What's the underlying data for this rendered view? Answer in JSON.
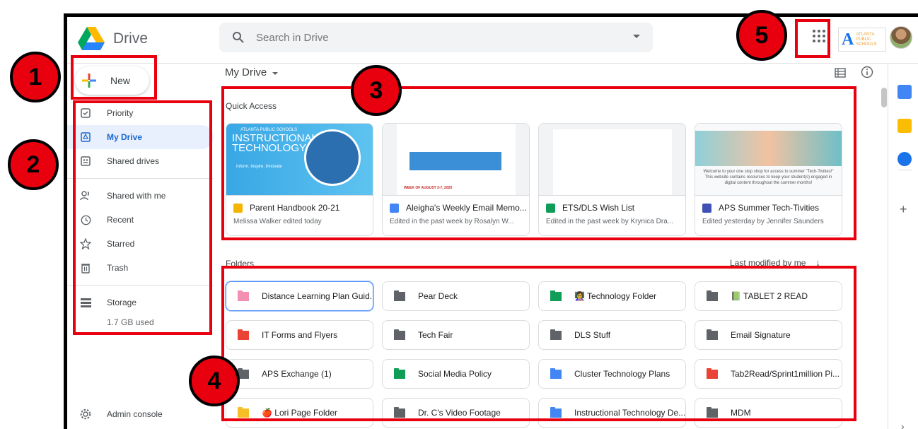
{
  "app": {
    "name": "Drive"
  },
  "search": {
    "placeholder": "Search in Drive"
  },
  "org": {
    "letter": "A",
    "line1": "ATLANTA",
    "line2": "PUBLIC",
    "line3": "SCHOOLS"
  },
  "sidebar": {
    "new_label": "New",
    "items": [
      {
        "label": "Priority",
        "icon": "priority-icon"
      },
      {
        "label": "My Drive",
        "icon": "my-drive-icon",
        "active": true
      },
      {
        "label": "Shared drives",
        "icon": "shared-drives-icon"
      },
      {
        "label": "Shared with me",
        "icon": "shared-with-me-icon"
      },
      {
        "label": "Recent",
        "icon": "clock-icon"
      },
      {
        "label": "Starred",
        "icon": "star-icon"
      },
      {
        "label": "Trash",
        "icon": "trash-icon"
      }
    ],
    "storage": {
      "label": "Storage",
      "used": "1.7 GB used"
    },
    "admin_label": "Admin console"
  },
  "main": {
    "title": "My Drive",
    "quick_access": {
      "label": "Quick Access",
      "cards": [
        {
          "title": "Parent Handbook 20-21",
          "subtitle": "Melissa Walker edited today",
          "type": "slides",
          "color": "#f4b400"
        },
        {
          "title": "Aleigha's Weekly Email Memo...",
          "subtitle": "Edited in the past week by Rosalyn W...",
          "type": "docs",
          "color": "#4285f4"
        },
        {
          "title": "ETS/DLS Wish List",
          "subtitle": "Edited in the past week by Krynica Dra...",
          "type": "sheets",
          "color": "#0f9d58"
        },
        {
          "title": "APS Summer Tech-Tivities",
          "subtitle": "Edited yesterday by Jennifer Saunders",
          "type": "sites",
          "color": "#3f51b5"
        }
      ],
      "thumb_text": {
        "card1_small": "ATLANTA PUBLIC SCHOOLS",
        "card1_main": "INSTRUCTIONAL TECHNOLOGY",
        "card1_tag": "Inform. Inspire. Innovate",
        "card2_date": "WEEK OF AUGUST 3-7, 2020",
        "card4_text": "Welcome to your one stop shop for access to summer \"Tech-Tivities!\" This website contains resources to keep your student(s) engaged in digital content throughout the summer months!"
      }
    },
    "folders": {
      "label": "Folders",
      "sort_label": "Last modified by me",
      "items": [
        {
          "name": "Distance Learning Plan Guid...",
          "color": "#f48fb1",
          "shared": true,
          "selected": true
        },
        {
          "name": "Pear Deck",
          "color": "#5f6368"
        },
        {
          "name": "👩‍🏫 Technology Folder",
          "color": "#0f9d58"
        },
        {
          "name": "📗 TABLET 2 READ",
          "color": "#5f6368"
        },
        {
          "name": "IT Forms and Flyers",
          "color": "#ea4335"
        },
        {
          "name": "Tech Fair",
          "color": "#5f6368"
        },
        {
          "name": "DLS Stuff",
          "color": "#5f6368"
        },
        {
          "name": "Email Signature",
          "color": "#5f6368"
        },
        {
          "name": "APS Exchange (1)",
          "color": "#5f6368"
        },
        {
          "name": "Social Media Policy",
          "color": "#0f9d58"
        },
        {
          "name": "Cluster Technology Plans",
          "color": "#4285f4"
        },
        {
          "name": "Tab2Read/Sprint1million Pi...",
          "color": "#ea4335",
          "shared": true
        },
        {
          "name": "🍎 Lori Page Folder",
          "color": "#f6bf26",
          "shared": true
        },
        {
          "name": "Dr. C's Video Footage",
          "color": "#5f6368",
          "shared": true
        },
        {
          "name": "Instructional Technology De...",
          "color": "#4285f4",
          "shared": true
        },
        {
          "name": "MDM",
          "color": "#5f6368"
        }
      ]
    }
  },
  "annotations": [
    "1",
    "2",
    "3",
    "4",
    "5"
  ],
  "colors": {
    "annotation_red": "#e8000f",
    "active_blue": "#1967d2",
    "active_bg": "#e8f0fe"
  }
}
